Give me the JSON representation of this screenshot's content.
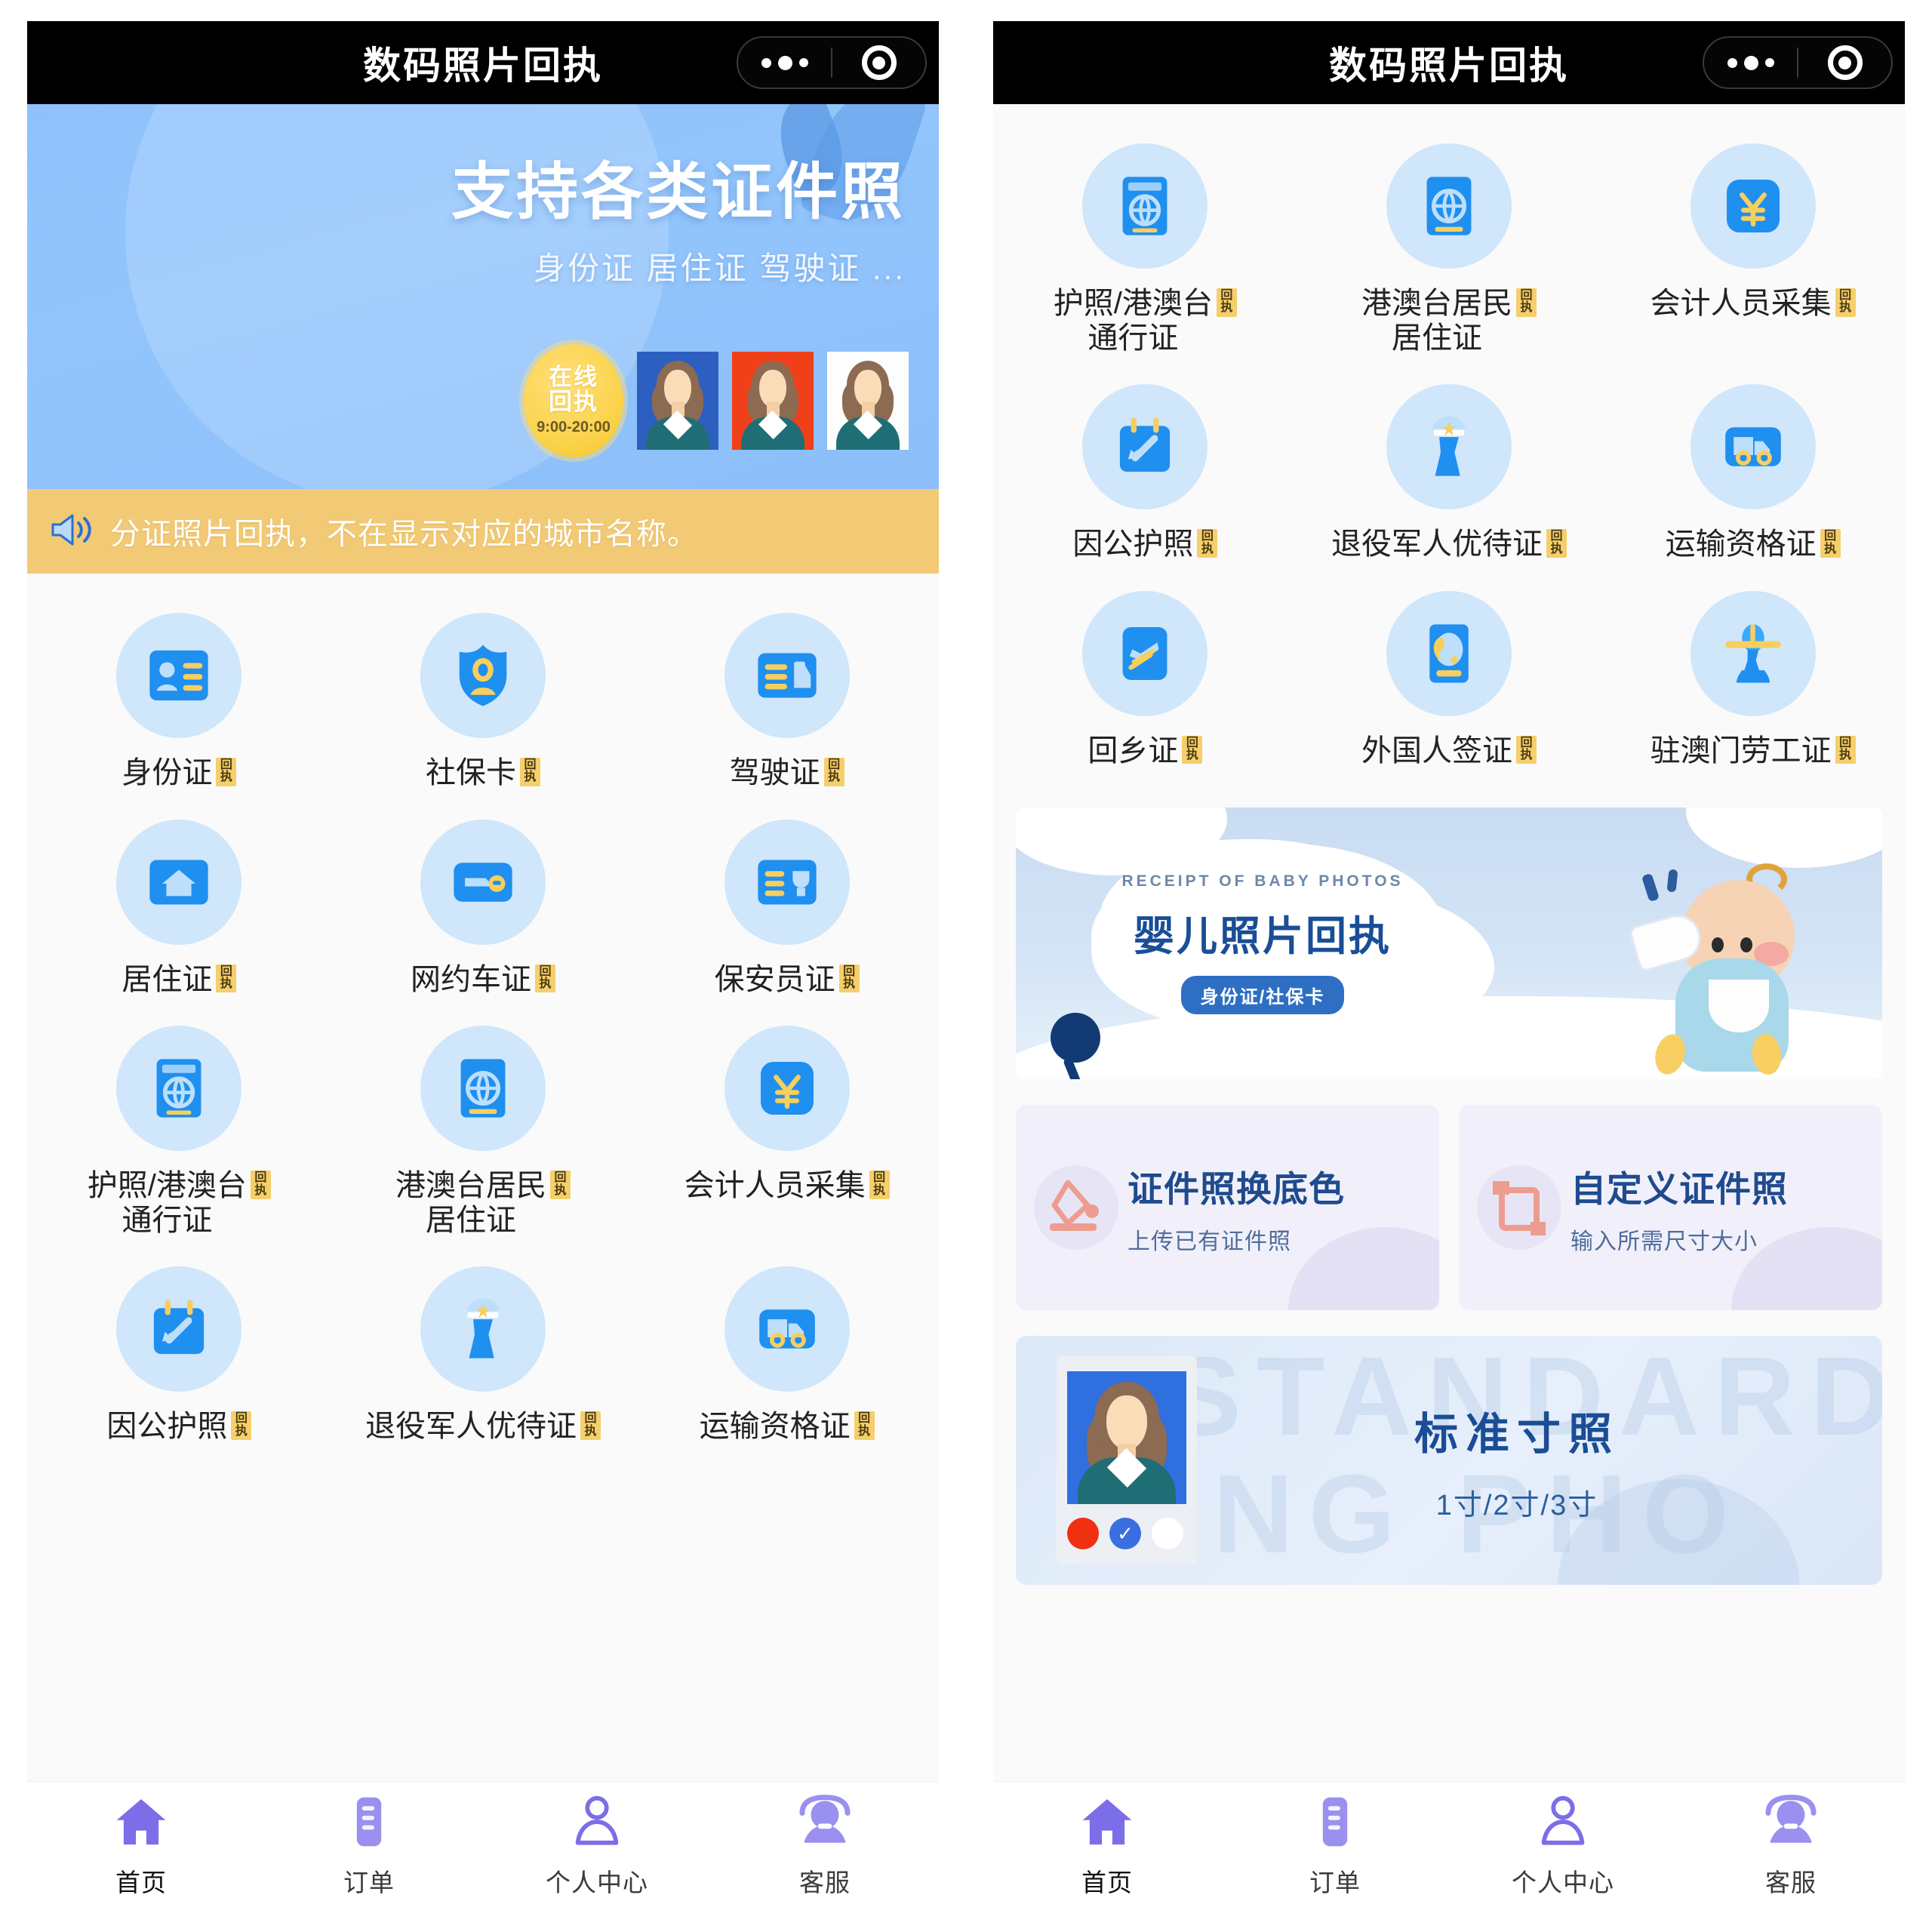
{
  "app": {
    "title": "数码照片回执",
    "colors": {
      "nav_bg": "#000000",
      "hero_blue": "#8fc2fb",
      "notice_yellow": "#f2ca76",
      "chip_yellow": "#f5cf6b",
      "icon_blue": "#1f8ff0",
      "tab_purple": "#7b6ee8"
    }
  },
  "capsule": {
    "more_icon": "ellipsis-icon",
    "target_icon": "target-icon"
  },
  "hero": {
    "title": "支持各类证件照",
    "subtitle": "身份证 居住证 驾驶证 ...",
    "badge_line1": "在线",
    "badge_line2": "回执",
    "badge_hours": "9:00-20:00",
    "thumbs": [
      "blue",
      "red",
      "white"
    ]
  },
  "notice": {
    "icon": "megaphone-icon",
    "text": "分证照片回执，不在显示对应的城市名称。"
  },
  "chip_label": "回执",
  "chip_chars": [
    "回",
    "执"
  ],
  "grid_left": [
    {
      "label": "身份证",
      "label2": "",
      "icon": "id-card-icon",
      "chip": true
    },
    {
      "label": "社保卡",
      "label2": "",
      "icon": "shield-person-icon",
      "chip": true
    },
    {
      "label": "驾驶证",
      "label2": "",
      "icon": "license-car-icon",
      "chip": true
    },
    {
      "label": "居住证",
      "label2": "",
      "icon": "home-card-icon",
      "chip": true
    },
    {
      "label": "网约车证",
      "label2": "",
      "icon": "ride-hailing-icon",
      "chip": true
    },
    {
      "label": "保安员证",
      "label2": "",
      "icon": "security-badge-icon",
      "chip": true
    },
    {
      "label": "护照/港澳台",
      "label2": "通行证",
      "icon": "passport-globe-icon",
      "chip": true
    },
    {
      "label": "港澳台居民",
      "label2": "居住证",
      "icon": "globe-book-icon",
      "chip": true
    },
    {
      "label": "会计人员采集",
      "label2": "",
      "icon": "yuan-icon",
      "chip": true
    },
    {
      "label": "因公护照",
      "label2": "",
      "icon": "plane-ticket-icon",
      "chip": true
    },
    {
      "label": "退役军人优待证",
      "label2": "",
      "icon": "veteran-icon",
      "chip": true
    },
    {
      "label": "运输资格证",
      "label2": "",
      "icon": "truck-icon",
      "chip": true
    }
  ],
  "grid_right": [
    {
      "label": "护照/港澳台",
      "label2": "通行证",
      "icon": "passport-globe-icon",
      "chip": true
    },
    {
      "label": "港澳台居民",
      "label2": "居住证",
      "icon": "globe-book-icon",
      "chip": true
    },
    {
      "label": "会计人员采集",
      "label2": "",
      "icon": "yuan-icon",
      "chip": true
    },
    {
      "label": "因公护照",
      "label2": "",
      "icon": "plane-ticket-icon",
      "chip": true
    },
    {
      "label": "退役军人优待证",
      "label2": "",
      "icon": "veteran-icon",
      "chip": true
    },
    {
      "label": "运输资格证",
      "label2": "",
      "icon": "truck-icon",
      "chip": true
    },
    {
      "label": "回乡证",
      "label2": "",
      "icon": "plane-card-icon",
      "chip": true
    },
    {
      "label": "外国人签证",
      "label2": "",
      "icon": "visa-globe-icon",
      "chip": true
    },
    {
      "label": "驻澳门劳工证",
      "label2": "",
      "icon": "worker-icon",
      "chip": true
    }
  ],
  "baby_banner": {
    "eyebrow": "RECEIPT OF BABY PHOTOS",
    "title": "婴儿照片回执",
    "chip": "身份证/社保卡"
  },
  "feature_cards": [
    {
      "title": "证件照换底色",
      "subtitle": "上传已有证件照",
      "icon": "paint-bucket-icon"
    },
    {
      "title": "自定义证件照",
      "subtitle": "输入所需尺寸大小",
      "icon": "crop-icon"
    }
  ],
  "standard_card": {
    "title": "标准寸照",
    "subtitle": "1寸/2寸/3寸",
    "watermark_line1": "STANDARD",
    "watermark_line2": "ING PHO",
    "swatches": [
      "red",
      "blue",
      "white"
    ],
    "selected_swatch": "blue",
    "check_glyph": "✓"
  },
  "tabbar": [
    {
      "label": "首页",
      "icon": "home-icon",
      "active": true
    },
    {
      "label": "订单",
      "icon": "orders-icon",
      "active": false
    },
    {
      "label": "个人中心",
      "icon": "person-icon",
      "active": false
    },
    {
      "label": "客服",
      "icon": "service-icon",
      "active": false
    }
  ]
}
